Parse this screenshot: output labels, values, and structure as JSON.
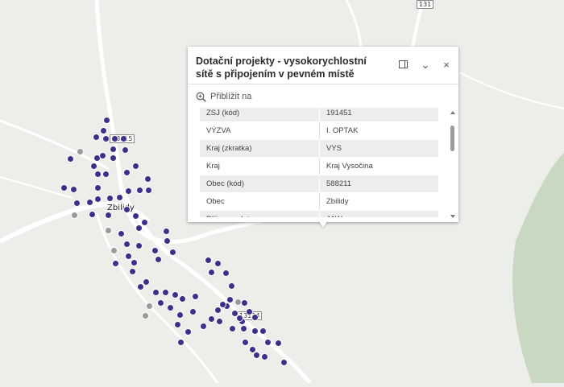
{
  "map": {
    "road_labels": {
      "r131": "131",
      "r13115": "13115",
      "r13114": "13114"
    },
    "town_label": "Zbilidy",
    "colors": {
      "point": "#3b2f8f",
      "point_inactive": "#9a9a9a",
      "background": "#eceeea",
      "forest": "#c9d8c0",
      "road": "#ffffff"
    }
  },
  "popup": {
    "title": "Dotační projekty - vysokorychlostní sítě s připojením v pevném místě",
    "buttons": {
      "dock": "dock-icon",
      "collapse": "⌄",
      "close": "×"
    },
    "zoom_label": "Přiblížit na",
    "rows": [
      {
        "key": "ZSJ (kód)",
        "value": "191451"
      },
      {
        "key": "VÝZVA",
        "value": "I. OPTAK"
      },
      {
        "key": "Kraj (zkratka)",
        "value": "VYS"
      },
      {
        "key": "Kraj",
        "value": "Kraj Vysočina"
      },
      {
        "key": "Obec (kód)",
        "value": "588211"
      },
      {
        "key": "Obec",
        "value": "Zbilidy"
      },
      {
        "key": "Příjemce dotace",
        "value": "JAW.cz s.r.o."
      }
    ]
  }
}
